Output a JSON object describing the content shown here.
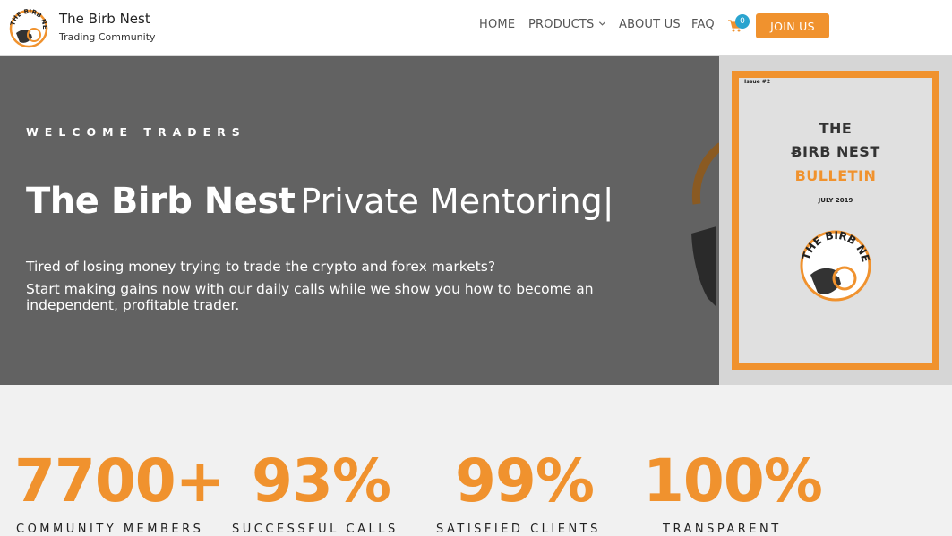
{
  "brand": {
    "title": "The Birb Nest",
    "tagline": "Trading Community",
    "logo_text": "THE BIRB NEST"
  },
  "nav": {
    "items": [
      "HOME",
      "PRODUCTS",
      "ABOUT US",
      "FAQ"
    ],
    "products_icon": "chevron-down-icon",
    "cart_icon": "shopping-cart-icon",
    "cart_count": "0",
    "join_label": "JOIN US"
  },
  "hero": {
    "eyebrow": "WELCOME TRADERS",
    "headline_strong": "The Birb Nest",
    "headline_light": "Private Mentoring",
    "cursor": "|",
    "paragraph_1": "Tired of losing money trying to trade the crypto and forex markets?",
    "paragraph_2": "Start making gains now with our daily calls while we show you how to become an independent, profitable trader."
  },
  "bulletin": {
    "issue": "Issue #2",
    "line_1": "THE",
    "line_2": "ɃIRB NEST",
    "line_3": "BULLETIN",
    "date": "JULY 2019"
  },
  "stats": [
    {
      "value": "7700+",
      "label": "COMMUNITY MEMBERS"
    },
    {
      "value": "93%",
      "label": "SUCCESSFUL CALLS"
    },
    {
      "value": "99%",
      "label": "SATISFIED CLIENTS"
    },
    {
      "value": "100%",
      "label": "TRANSPARENT"
    }
  ],
  "colors": {
    "accent": "#f0922e",
    "hero_bg": "#626262",
    "badge": "#2aa4cf",
    "page_bg": "#f1f1f1"
  }
}
